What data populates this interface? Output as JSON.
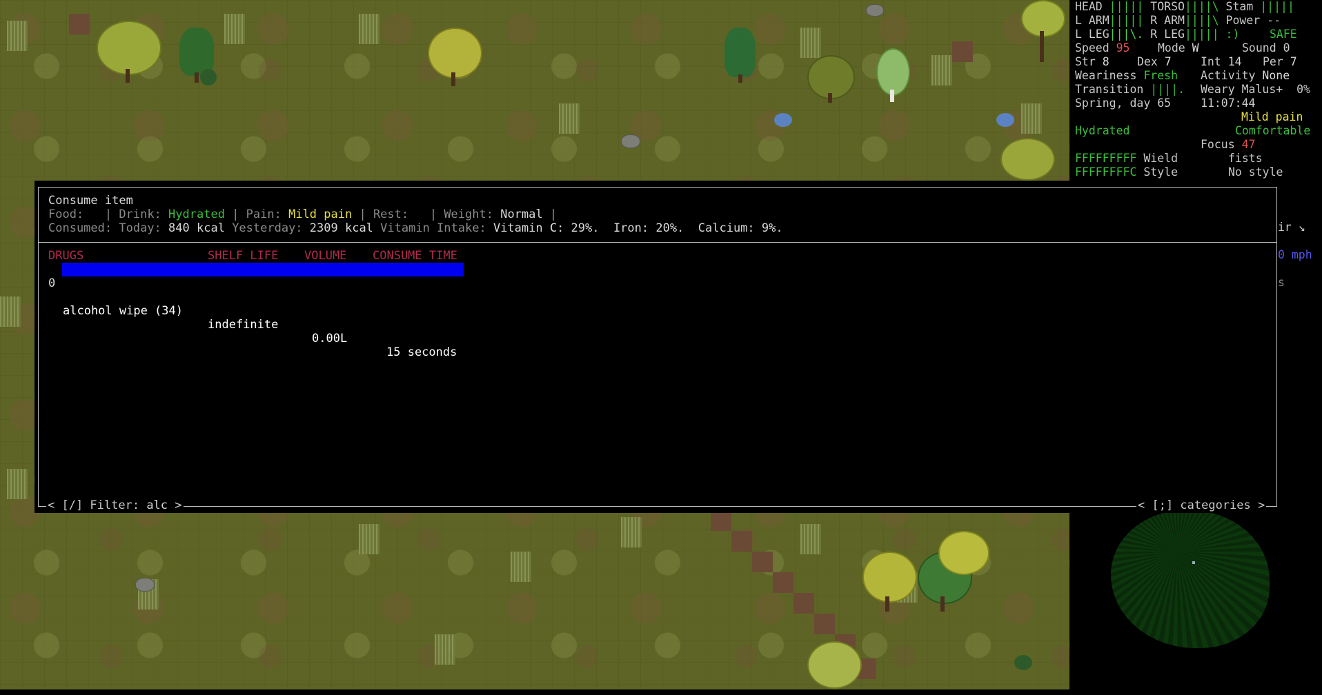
{
  "sidebar": {
    "line1": {
      "a": "HEAD ",
      "a_bar": "|||||",
      "b": " TORSO",
      "b_bar": "||||\\",
      "c": " Stam ",
      "c_bar": "|||||"
    },
    "line2": {
      "a": "L ARM",
      "a_bar": "|||||",
      "b": " R ARM",
      "b_bar": "||||\\",
      "c": " Power --"
    },
    "line3": {
      "a": "L LEG",
      "a_bar": "|||\\.",
      "b": " R LEG",
      "b_bar": "||||| :)",
      "c": "SAFE"
    },
    "line4": {
      "speed_label": "Speed ",
      "speed": "95",
      "mode_label": "Mode ",
      "mode": "W",
      "sound": "Sound 0"
    },
    "line5": {
      "str_label": "Str ",
      "str": "8",
      "dex_label": "Dex ",
      "dex": "7",
      "int_label": "Int ",
      "int": "14",
      "per_label": "Per ",
      "per": "7"
    },
    "line6": {
      "weariness_label": "Weariness ",
      "weariness": "Fresh",
      "activity_label": "Activity ",
      "activity": "None"
    },
    "line7": {
      "transition_label": "Transition ",
      "transition": "||||.",
      "malus": "Weary Malus+  0%"
    },
    "line8": {
      "season": "Spring, day 65",
      "time": "11:07:44"
    },
    "line9": {
      "pain": "Mild pain"
    },
    "line10": {
      "hydration": "Hydrated",
      "comfort": "Comfortable"
    },
    "line11": {
      "focus_label": "Focus ",
      "focus": "47"
    },
    "line12": {
      "code": "FFFFFFFFF",
      "label": " Wield",
      "value": "fists"
    },
    "line13": {
      "code": "FFFFFFFFC",
      "label": " Style",
      "value": "No style"
    },
    "fragment_ir": "ir ↘",
    "fragment_mph": "0 mph",
    "fragment_s": "s"
  },
  "dialog": {
    "title": "Consume item",
    "food_label": "Food:",
    "drink_label": "Drink:",
    "drink_value": "Hydrated",
    "pain_label": "Pain:",
    "pain_value": "Mild pain",
    "rest_label": "Rest:",
    "weight_label": "Weight:",
    "weight_value": "Normal",
    "consumed_label": "Consumed:",
    "today_label": "Today:",
    "today_value": "840 kcal",
    "yesterday_label": "Yesterday:",
    "yesterday_value": "2309 kcal",
    "vitamin_label": "Vitamin Intake:",
    "vitamin_value": "Vitamin C: 29%.  Iron: 20%.  Calcium: 9%.",
    "columns": [
      "DRUGS",
      "SHELF LIFE",
      "VOLUME",
      "CONSUME TIME"
    ],
    "items": [
      {
        "key": "0",
        "name": "alcohol wipe (34)",
        "shelf_life": "indefinite",
        "volume": "0.00L",
        "consume_time": "15 seconds"
      }
    ],
    "filter_label": "[/] Filter: ",
    "filter_value": "alc",
    "categories_label": "[;] categories"
  }
}
